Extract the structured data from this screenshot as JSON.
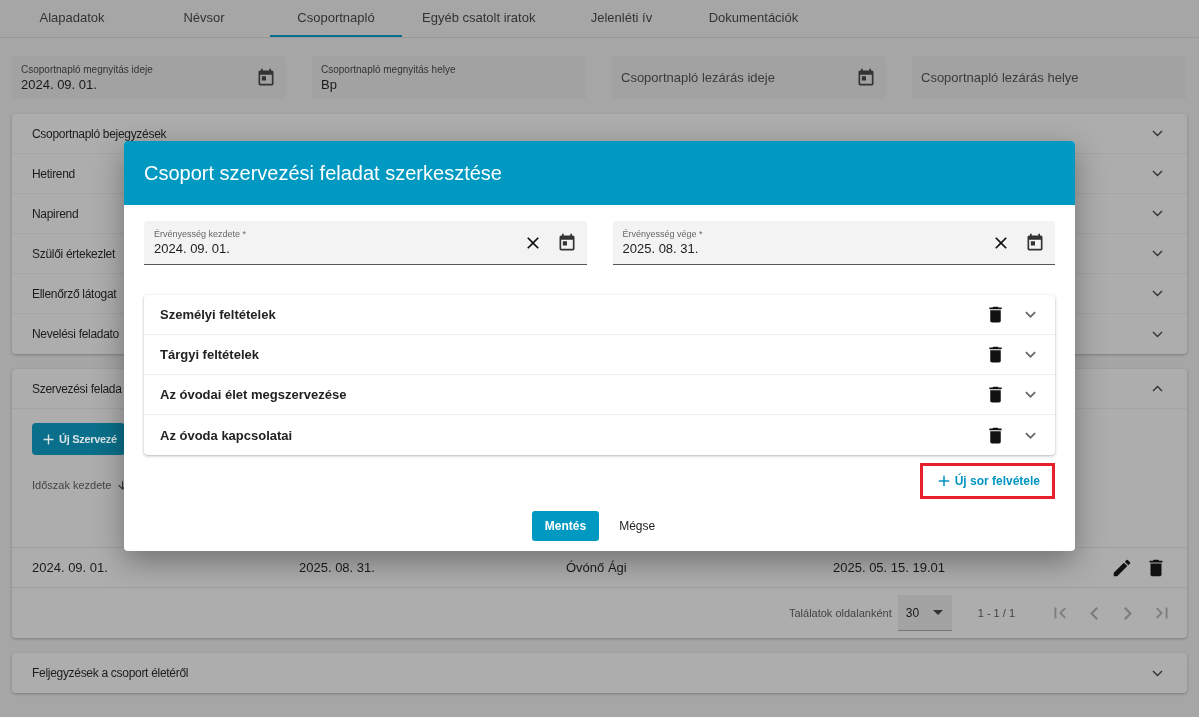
{
  "tabs": [
    {
      "label": "Alapadatok",
      "selected": false
    },
    {
      "label": "Névsor",
      "selected": false
    },
    {
      "label": "Csoportnapló",
      "selected": true
    },
    {
      "label": "Egyéb csatolt iratok",
      "selected": false
    },
    {
      "label": "Jelenléti ív",
      "selected": false
    },
    {
      "label": "Dokumentációk",
      "selected": false
    }
  ],
  "header_fields": [
    {
      "label": "Csoportnapló megnyitás ideje",
      "value": "2024. 09. 01.",
      "calendar": true
    },
    {
      "label": "Csoportnapló megnyitás helye",
      "value": "Bp",
      "calendar": false
    },
    {
      "label": "Csoportnapló lezárás ideje",
      "calendar": true
    },
    {
      "label": "Csoportnapló lezárás helye",
      "calendar": false
    }
  ],
  "sections": [
    {
      "title": "Csoportnapló bejegyzések"
    },
    {
      "title": "Hetirend"
    },
    {
      "title": "Napirend"
    },
    {
      "title": "Szülői értekezlet"
    },
    {
      "title": "Ellenőrző látogat"
    },
    {
      "title": "Nevelési feladato"
    }
  ],
  "tasks_panel": {
    "title": "Szervezési felada",
    "expanded": true,
    "new_button": "Új Szervezé",
    "sort_column": "Időszak kezdete",
    "rows": [
      {
        "cells": [
          "2024. 09. 01.",
          "2025. 08. 31.",
          "Óvónő Ági",
          "2025. 05. 15. 19.01"
        ]
      }
    ],
    "pagination": {
      "per_page_label": "Találatok oldalanként",
      "per_page": "30",
      "range": "1 - 1 / 1",
      "nav": [
        {
          "kind": "first",
          "disabled": true
        },
        {
          "kind": "prev",
          "disabled": true
        },
        {
          "kind": "next",
          "disabled": true
        },
        {
          "kind": "last",
          "disabled": true
        }
      ]
    }
  },
  "notes_panel": {
    "title": "Feljegyzések a csoport életéről",
    "expanded": false
  },
  "dialog": {
    "title": "Csoport szervezési feladat szerkesztése",
    "fields": [
      {
        "label": "Érvényesség kezdete *",
        "value": "2024. 09. 01."
      },
      {
        "label": "Érvényesség vége *",
        "value": "2025. 08. 31."
      }
    ],
    "items": [
      {
        "title": "Személyi feltételek",
        "expanded": false
      },
      {
        "title": "Tárgyi feltételek",
        "expanded": false
      },
      {
        "title": "Az óvodai élet megszervezése",
        "expanded": false
      },
      {
        "title": "Az óvoda kapcsolatai",
        "expanded": false
      }
    ],
    "add_row_button": "Új sor felvétele",
    "highlighted": true,
    "save_button": "Mentés",
    "cancel_button": "Mégse"
  }
}
